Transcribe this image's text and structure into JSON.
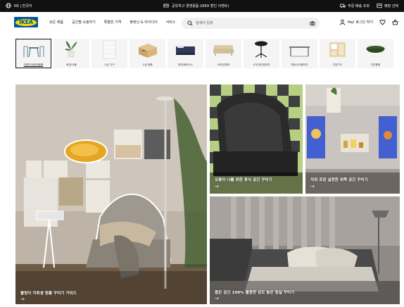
{
  "topbar": {
    "language": "KR | 한국어",
    "promo": "공유하고 경쟁용품 (IKEA 할인 이벤트)",
    "track_order": "주문 배송 조회",
    "store": "매장 선택"
  },
  "header": {
    "logo_text": "IKEA",
    "nav": [
      "모든 제품",
      "공간별 쇼핑하기",
      "특별한 가격",
      "플래닝 & 아이디어",
      "서비스"
    ],
    "search_placeholder": "검색어 입력",
    "login_label": "Hej! 로그인 하기"
  },
  "categories": [
    {
      "label": "아웃도어/야외용품",
      "icon": "outdoor-set-icon",
      "active": true
    },
    {
      "label": "화분/식물",
      "icon": "plant-icon",
      "active": false
    },
    {
      "label": "수납 가구",
      "icon": "drawer-chest-icon",
      "active": false
    },
    {
      "label": "수납 용품",
      "icon": "storage-box-icon",
      "active": false
    },
    {
      "label": "침대/매트리스",
      "icon": "bed-icon",
      "active": false
    },
    {
      "label": "소파/암체어",
      "icon": "sofa-icon",
      "active": false
    },
    {
      "label": "사무/게이밍의자",
      "icon": "office-chair-icon",
      "active": false
    },
    {
      "label": "책상/사무용의자",
      "icon": "desk-icon",
      "active": false
    },
    {
      "label": "주방가구",
      "icon": "kitchen-cabinet-icon",
      "active": false
    },
    {
      "label": "주방용품",
      "icon": "bowl-icon",
      "active": false
    }
  ],
  "tiles": [
    {
      "caption": "불멍이 자취생 원룸 꾸미기 가이드",
      "arrow": "→"
    },
    {
      "caption": "오롯이 나를 위한 휴식 공간 꾸미기",
      "arrow": "→"
    },
    {
      "caption": "자취 로망 실현한 위쪽 공간 꾸미기",
      "arrow": "→"
    },
    {
      "caption": "좁은 공간 100% 활용한 감도 높은 침실 꾸미기",
      "arrow": "→"
    }
  ],
  "colors": {
    "ikea_blue": "#0058a3",
    "ikea_yellow": "#ffdb00",
    "topbar_bg": "#111111"
  }
}
